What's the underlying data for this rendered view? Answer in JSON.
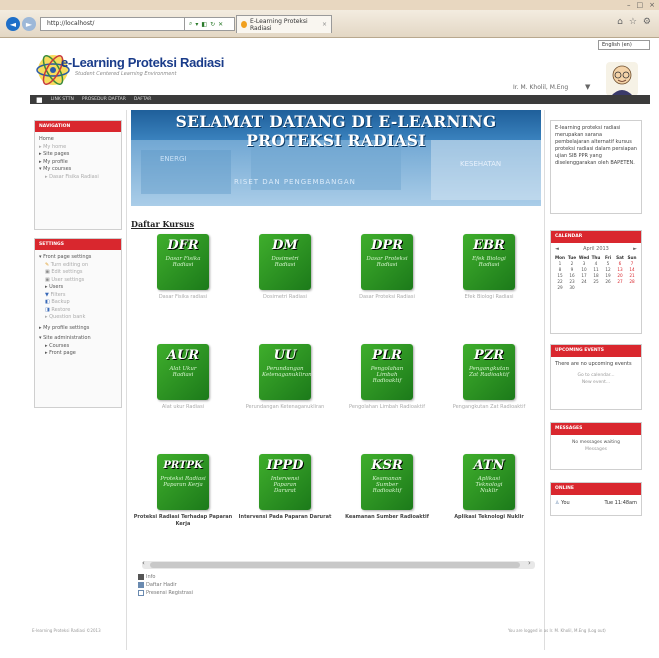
{
  "browser": {
    "address": "http://localhost/",
    "tab_title": "E-Learning Proteksi Radiasi"
  },
  "header": {
    "language": "English (en)",
    "site_name": "e-Learning Proteksi Radiasi",
    "tagline": "Student Centered Learning Environment",
    "user": "Ir. M. Kholil, M.Eng",
    "user_menu_caret": "▼"
  },
  "navbar": {
    "items": [
      "LINK STTN",
      "PROSEDUR DAFTAR",
      "DAFTAR"
    ]
  },
  "navigation_block": {
    "title": "NAVIGATION",
    "items": [
      "Home",
      "My home",
      "Site pages",
      "My profile",
      "My courses",
      "Dasar Fisika Radiasi"
    ]
  },
  "settings_block": {
    "title": "SETTINGS",
    "items": [
      "Front page settings",
      "Turn editing on",
      "Edit settings",
      "User settings",
      "Users",
      "Filters",
      "Backup",
      "Restore",
      "Question bank",
      "My profile settings",
      "Site administration",
      "Courses",
      "Front page"
    ]
  },
  "banner": {
    "title": "SELAMAT DATANG DI E-LEARNING PROTEKSI RADIASI",
    "word1": "ENERGI",
    "word2": "RISET DAN PENGEMBANGAN",
    "word3": "KESEHATAN"
  },
  "section_title": "Daftar Kursus",
  "courses": [
    {
      "abbr": "DFR",
      "full": "Dasar Fisika Radiasi",
      "name": "Dasar Fisika radiasi"
    },
    {
      "abbr": "DM",
      "full": "Dosimetri Radiasi",
      "name": "Dosimetri Radiasi"
    },
    {
      "abbr": "DPR",
      "full": "Dasar Proteksi Radiasi",
      "name": "Dasar Proteksi Radiasi"
    },
    {
      "abbr": "EBR",
      "full": "Efek Biologi Radiasi",
      "name": "Efek Biologi Radiasi"
    },
    {
      "abbr": "AUR",
      "full": "Alat Ukur Radiasi",
      "name": "Alat ukur Radiasi"
    },
    {
      "abbr": "UU",
      "full": "Perundangan Ketenaganukliran",
      "name": "Perundangan Ketenaganukliran"
    },
    {
      "abbr": "PLR",
      "full": "Pengolahan Limbah Radioaktif",
      "name": "Pengolahan Limbah Radioaktif"
    },
    {
      "abbr": "PZR",
      "full": "Pengangkutan Zat Radioaktif",
      "name": "Pengangkutan Zat Radioaktif"
    },
    {
      "abbr": "PRTPK",
      "full": "Proteksi Radiasi Paparan Kerja",
      "name": "Proteksi Radiasi Terhadap Paparan Kerja"
    },
    {
      "abbr": "IPPD",
      "full": "Intervensi Paparan Darurat",
      "name": "Intervensi Pada Paparan Darurat"
    },
    {
      "abbr": "KSR",
      "full": "Keamanan Sumber Radioaktif",
      "name": "Keamanan Sumber Radioaktif"
    },
    {
      "abbr": "ATN",
      "full": "Aplikasi Teknologi Nuklir",
      "name": "Aplikasi Teknologi Nuklir"
    }
  ],
  "tool_links": [
    "Info",
    "Daftar Hadir",
    "Presensi Registrasi"
  ],
  "about_text": "E-learning proteksi radiasi merupakan sarana pembelajaran alternatif kursus proteksi radiasi dalam persiapan ujian SIB PPR yang diselenggarakan oleh BAPETEN.",
  "calendar": {
    "title": "CALENDAR",
    "month": "April 2013",
    "prev": "◄",
    "next": "►",
    "days": [
      "Mon",
      "Tue",
      "Wed",
      "Thu",
      "Fri",
      "Sat",
      "Sun"
    ],
    "dates": [
      "1",
      "2",
      "3",
      "4",
      "5",
      "6",
      "7",
      "8",
      "9",
      "10",
      "11",
      "12",
      "13",
      "14",
      "15",
      "16",
      "17",
      "18",
      "19",
      "20",
      "21",
      "22",
      "23",
      "24",
      "25",
      "26",
      "27",
      "28",
      "29",
      "30"
    ]
  },
  "upcoming": {
    "title": "UPCOMING EVENTS",
    "text": "There are no upcoming events",
    "link1": "Go to calendar...",
    "link2": "New event..."
  },
  "messages": {
    "title": "MESSAGES",
    "text": "No messages waiting",
    "link": "Messages"
  },
  "online": {
    "title": "ONLINE",
    "user": "You",
    "time": "Tue 11:48am"
  },
  "footer": {
    "left": "E-learning Proteksi Radiasi ©2013",
    "right": "You are logged in as Ir. M. Kholil, M.Eng (Log out)"
  }
}
